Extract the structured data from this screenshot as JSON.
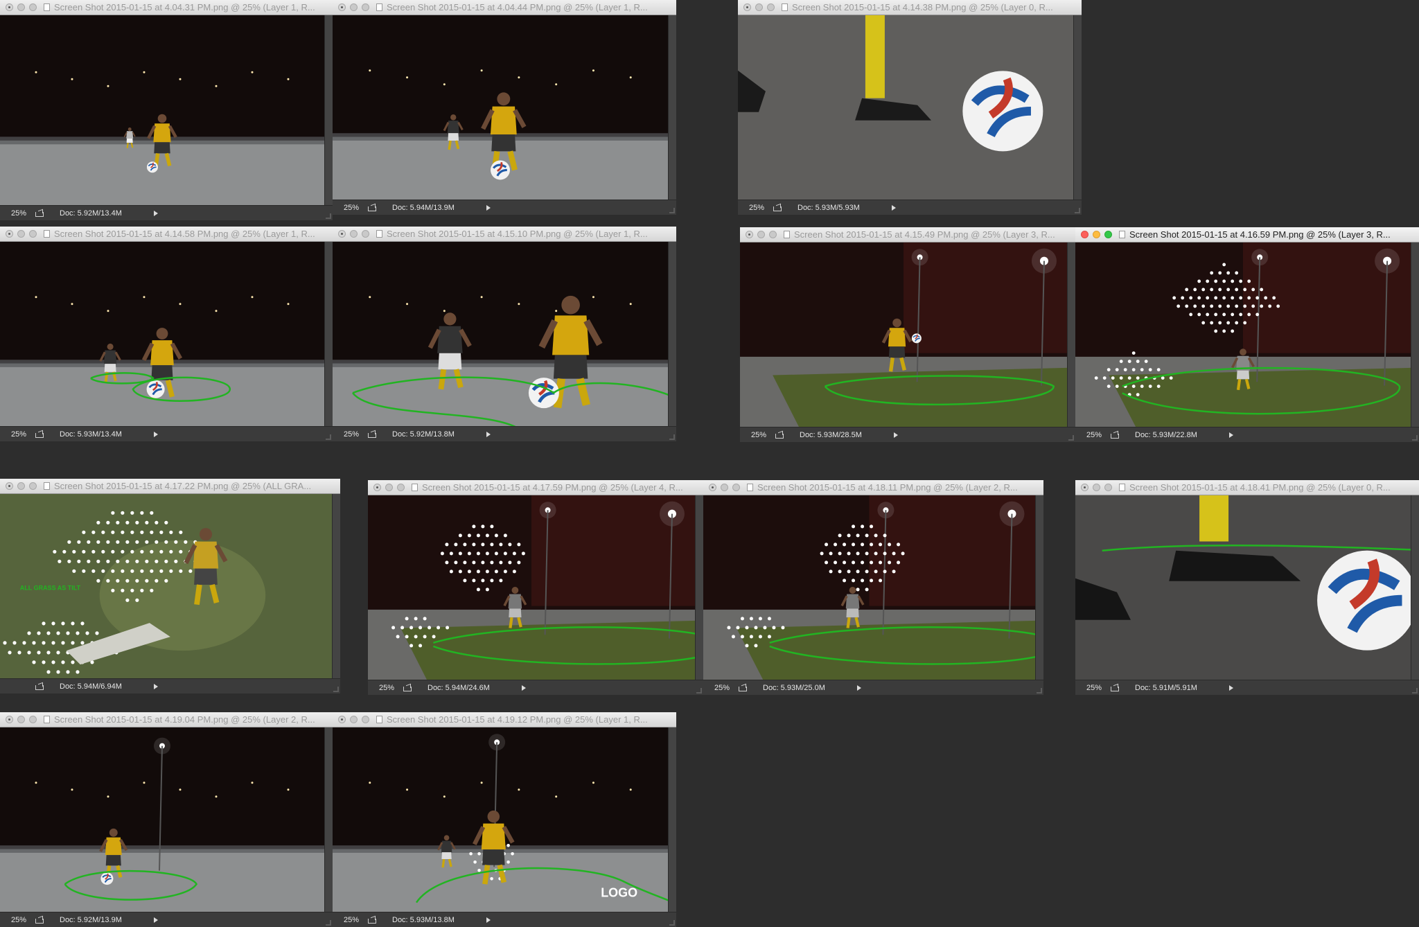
{
  "app": "Photoshop",
  "colors": {
    "desktop": "#2d2d2d",
    "annotation_green": "#22b422",
    "dots": "#ffffff"
  },
  "windows": [
    {
      "id": "w1",
      "title": "Screen Shot 2015-01-15 at 4.04.31 PM.png @ 25% (Layer 1, R...",
      "zoom": "25%",
      "doc": "Doc: 5.92M/13.4M",
      "scene": "A",
      "active": false
    },
    {
      "id": "w2",
      "title": "Screen Shot 2015-01-15 at 4.04.44 PM.png @ 25% (Layer 1, R...",
      "zoom": "25%",
      "doc": "Doc: 5.94M/13.9M",
      "scene": "B",
      "active": false
    },
    {
      "id": "w3",
      "title": "Screen Shot 2015-01-15 at 4.14.38 PM.png @ 25% (Layer 0, R...",
      "zoom": "25%",
      "doc": "Doc: 5.93M/5.93M",
      "scene": "C",
      "active": false
    },
    {
      "id": "w4",
      "title": "Screen Shot 2015-01-15 at 4.14.58 PM.png @ 25% (Layer 1, R...",
      "zoom": "25%",
      "doc": "Doc: 5.93M/13.4M",
      "scene": "D",
      "active": false
    },
    {
      "id": "w5",
      "title": "Screen Shot 2015-01-15 at 4.15.10 PM.png @ 25% (Layer 1, R...",
      "zoom": "25%",
      "doc": "Doc: 5.92M/13.8M",
      "scene": "E",
      "active": false
    },
    {
      "id": "w6",
      "title": "Screen Shot 2015-01-15 at 4.15.49 PM.png @ 25% (Layer 3, R...",
      "zoom": "25%",
      "doc": "Doc: 5.93M/28.5M",
      "scene": "F",
      "active": false
    },
    {
      "id": "w7",
      "title": "Screen Shot 2015-01-15 at 4.16.59 PM.png @ 25% (Layer 3, R...",
      "zoom": "25%",
      "doc": "Doc: 5.93M/22.8M",
      "scene": "G",
      "active": true
    },
    {
      "id": "w8",
      "title": "Screen Shot 2015-01-15 at 4.17.22 PM.png @ 25% (ALL GRA...",
      "zoom": "",
      "doc": "Doc: 5.94M/6.94M",
      "scene": "H",
      "active": false,
      "overlay_text": "ALL GRASS AS TILT"
    },
    {
      "id": "w9",
      "title": "Screen Shot 2015-01-15 at 4.17.59 PM.png @ 25% (Layer 4, R...",
      "zoom": "25%",
      "doc": "Doc: 5.94M/24.6M",
      "scene": "I",
      "active": false
    },
    {
      "id": "w10",
      "title": "Screen Shot 2015-01-15 at 4.18.11 PM.png @ 25% (Layer 2, R...",
      "zoom": "25%",
      "doc": "Doc: 5.93M/25.0M",
      "scene": "J",
      "active": false
    },
    {
      "id": "w11",
      "title": "Screen Shot 2015-01-15 at 4.18.41 PM.png @ 25% (Layer 0, R...",
      "zoom": "25%",
      "doc": "Doc: 5.91M/5.91M",
      "scene": "K",
      "active": false
    },
    {
      "id": "w12",
      "title": "Screen Shot 2015-01-15 at 4.19.04 PM.png @ 25% (Layer 2, R...",
      "zoom": "25%",
      "doc": "Doc: 5.92M/13.9M",
      "scene": "L",
      "active": false
    },
    {
      "id": "w13",
      "title": "Screen Shot 2015-01-15 at 4.19.12 PM.png @ 25% (Layer 1, R...",
      "zoom": "25%",
      "doc": "Doc: 5.93M/13.8M",
      "scene": "M",
      "active": false,
      "overlay_text": "LOGO"
    }
  ]
}
